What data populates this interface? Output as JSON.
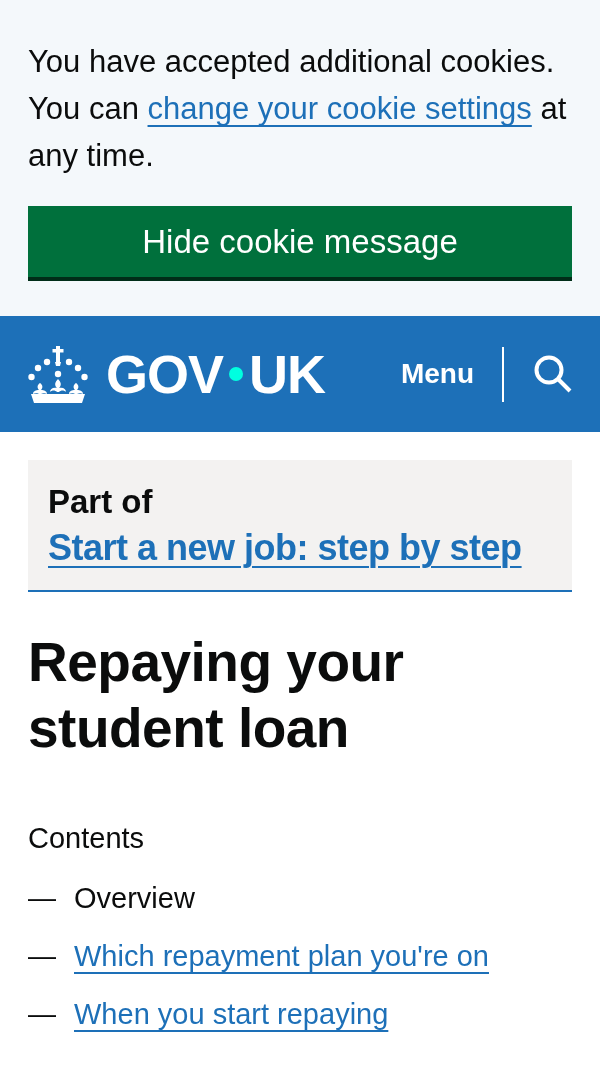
{
  "cookie_banner": {
    "message": {
      "before": "You have accepted additional cookies. You can ",
      "link": "change your cookie settings",
      "after": " at any time."
    },
    "button": "Hide cookie message"
  },
  "header": {
    "logo": {
      "left": "GOV",
      "right": "UK"
    },
    "menu_button": "Menu"
  },
  "part_of": {
    "label": "Part of",
    "link": "Start a new job: step by step"
  },
  "title": "Repaying your student loan",
  "contents": {
    "heading": "Contents",
    "items": [
      {
        "marker": "—",
        "label": "Overview",
        "selected": true
      },
      {
        "marker": "—",
        "label": "Which repayment plan you're on",
        "selected": false
      },
      {
        "marker": "—",
        "label": "When you start repaying",
        "selected": false
      }
    ]
  }
}
